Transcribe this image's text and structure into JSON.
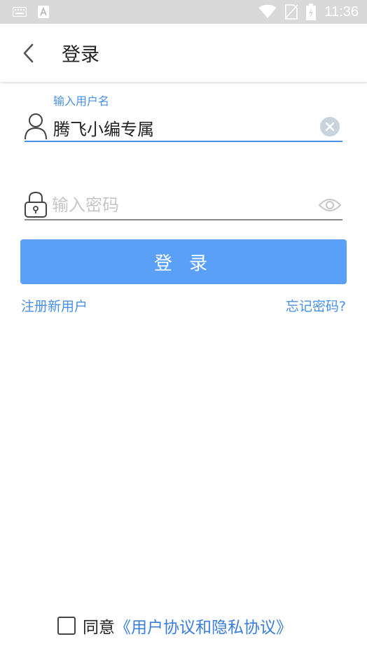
{
  "status_bar": {
    "time": "11:36"
  },
  "app_bar": {
    "title": "登录",
    "back_icon": "chevron-left-icon"
  },
  "form": {
    "username_label": "输入用户名",
    "username_value": "腾飞小编专属",
    "password_placeholder": "输入密码",
    "login_button_label": "登 录"
  },
  "links": {
    "register": "注册新用户",
    "forgot_password": "忘记密码?"
  },
  "agreement": {
    "prefix": "同意",
    "link": "《用户协议和隐私协议》"
  },
  "colors": {
    "accent": "#4a90e2",
    "button": "#5aa0f6",
    "status_bar": "#d9d9d9"
  }
}
